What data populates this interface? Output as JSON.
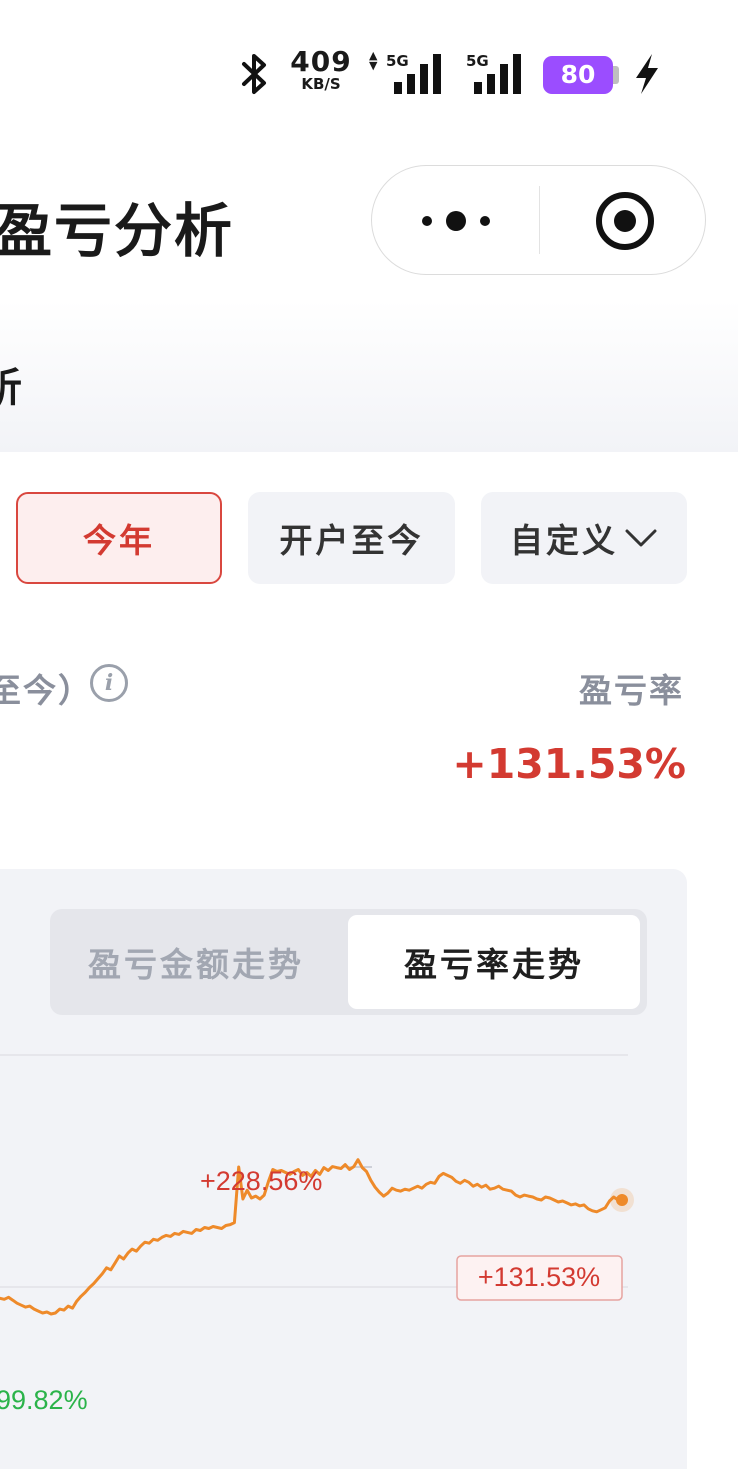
{
  "status_bar": {
    "net_speed": "409",
    "net_unit": "KB/S",
    "network1": "5G",
    "network2": "5G",
    "battery": "80",
    "colors": {
      "battery": "#9b4dff"
    }
  },
  "nav": {
    "title": "盈亏分析",
    "more_icon": "more-dots-icon",
    "close_icon": "target-circle-icon"
  },
  "section": {
    "title": "析"
  },
  "period_buttons": [
    {
      "label": "今年",
      "active": true
    },
    {
      "label": "开户至今",
      "active": false
    },
    {
      "label": "自定义",
      "active": false
    }
  ],
  "summary": {
    "period_label": "至今）",
    "rate_label": "盈亏率",
    "rate_value": "+131.53%",
    "colors": {
      "positive": "#d33a31"
    }
  },
  "chart_tabs": [
    {
      "label": "盈亏金额走势",
      "active": false
    },
    {
      "label": "盈亏率走势",
      "active": true
    }
  ],
  "chart_data": {
    "type": "line",
    "series": [
      {
        "values": [
          95,
          94,
          96,
          93,
          90,
          88,
          86,
          87,
          84,
          82,
          80,
          81,
          79,
          80,
          84,
          83,
          87,
          85,
          92,
          97,
          101,
          106,
          110,
          115,
          120,
          126,
          124,
          131,
          138,
          135,
          141,
          145,
          143,
          148,
          152,
          151,
          155,
          154,
          157,
          159,
          158,
          161,
          160,
          163,
          162,
          161,
          165,
          164,
          167,
          166,
          168,
          167,
          166,
          169,
          170,
          172,
          228.56,
          196,
          205,
          197,
          199,
          196,
          200,
          214,
          226,
          224,
          225,
          223,
          221,
          224,
          226,
          220,
          223,
          219,
          225,
          221,
          228,
          225,
          229,
          228,
          227,
          231,
          226,
          229,
          236,
          228,
          224,
          215,
          208,
          203,
          199,
          202,
          207,
          205,
          204,
          206,
          205,
          207,
          209,
          207,
          211,
          213,
          212,
          219,
          222,
          220,
          218,
          214,
          212,
          215,
          213,
          209,
          211,
          208,
          210,
          206,
          207,
          209,
          206,
          205,
          204,
          200,
          198,
          200,
          199,
          198,
          196,
          195,
          198,
          197,
          195,
          193,
          194,
          192,
          190,
          191,
          189,
          190,
          186,
          184,
          183,
          185,
          187,
          194,
          198,
          195,
          131.53
        ]
      }
    ],
    "annotations": [
      {
        "label": "+228.56%",
        "kind": "max"
      },
      {
        "label": "+131.53%",
        "kind": "latest"
      },
      {
        "label": "99.82%",
        "kind": "min"
      }
    ],
    "colors": {
      "line": "#ee8a2a",
      "max_label": "#d33a31",
      "min_label": "#2bb34a",
      "latest_label": "#d33a31"
    }
  }
}
